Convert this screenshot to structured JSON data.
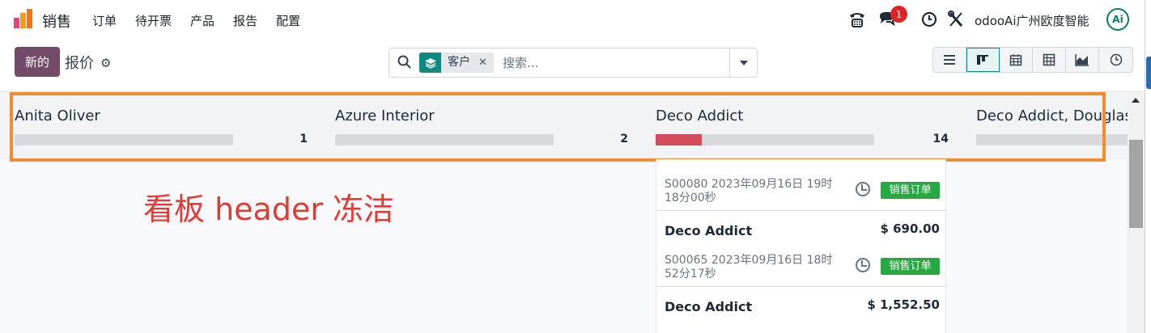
{
  "app": {
    "name": "销售",
    "menu": [
      "订单",
      "待开票",
      "产品",
      "报告",
      "配置"
    ]
  },
  "systray": {
    "message_count": "1",
    "company": "odooAi广州欧度智能",
    "avatar_initials": "Ai"
  },
  "control_panel": {
    "new_label": "新的",
    "breadcrumb": "报价",
    "search": {
      "facet_label": "客户",
      "placeholder": "搜索..."
    },
    "views": [
      "list-view-icon",
      "kanban-view-icon",
      "calendar-view-icon",
      "pivot-view-icon",
      "graph-view-icon",
      "activity-view-icon"
    ],
    "active_view": "kanban-view-icon"
  },
  "kanban": {
    "columns": [
      {
        "title": "Anita Oliver",
        "count": "1",
        "progress": 0
      },
      {
        "title": "Azure Interior",
        "count": "2",
        "progress": 0
      },
      {
        "title": "Deco Addict",
        "count": "14",
        "progress": 0.21
      },
      {
        "title": "Deco Addict, Douglas",
        "count": "",
        "progress": 0
      }
    ],
    "cards": [
      {
        "ref": "S00080 2023年09月16日 19时18分00秒",
        "tag": "销售订单"
      },
      {
        "title": "Deco Addict",
        "amount": "$ 690.00",
        "ref": "S00065 2023年09月16日 18时52分17秒",
        "tag": "销售订单"
      },
      {
        "title": "Deco Addict",
        "amount": "$ 1,552.50"
      }
    ]
  },
  "annotation": "看板 header 冻洁",
  "colors": {
    "brand": "#714b67",
    "accent": "#0e8a83",
    "highlight": "#f28b32",
    "annotation": "#e53935",
    "tag": "#28a745",
    "progress": "#d44c59"
  }
}
